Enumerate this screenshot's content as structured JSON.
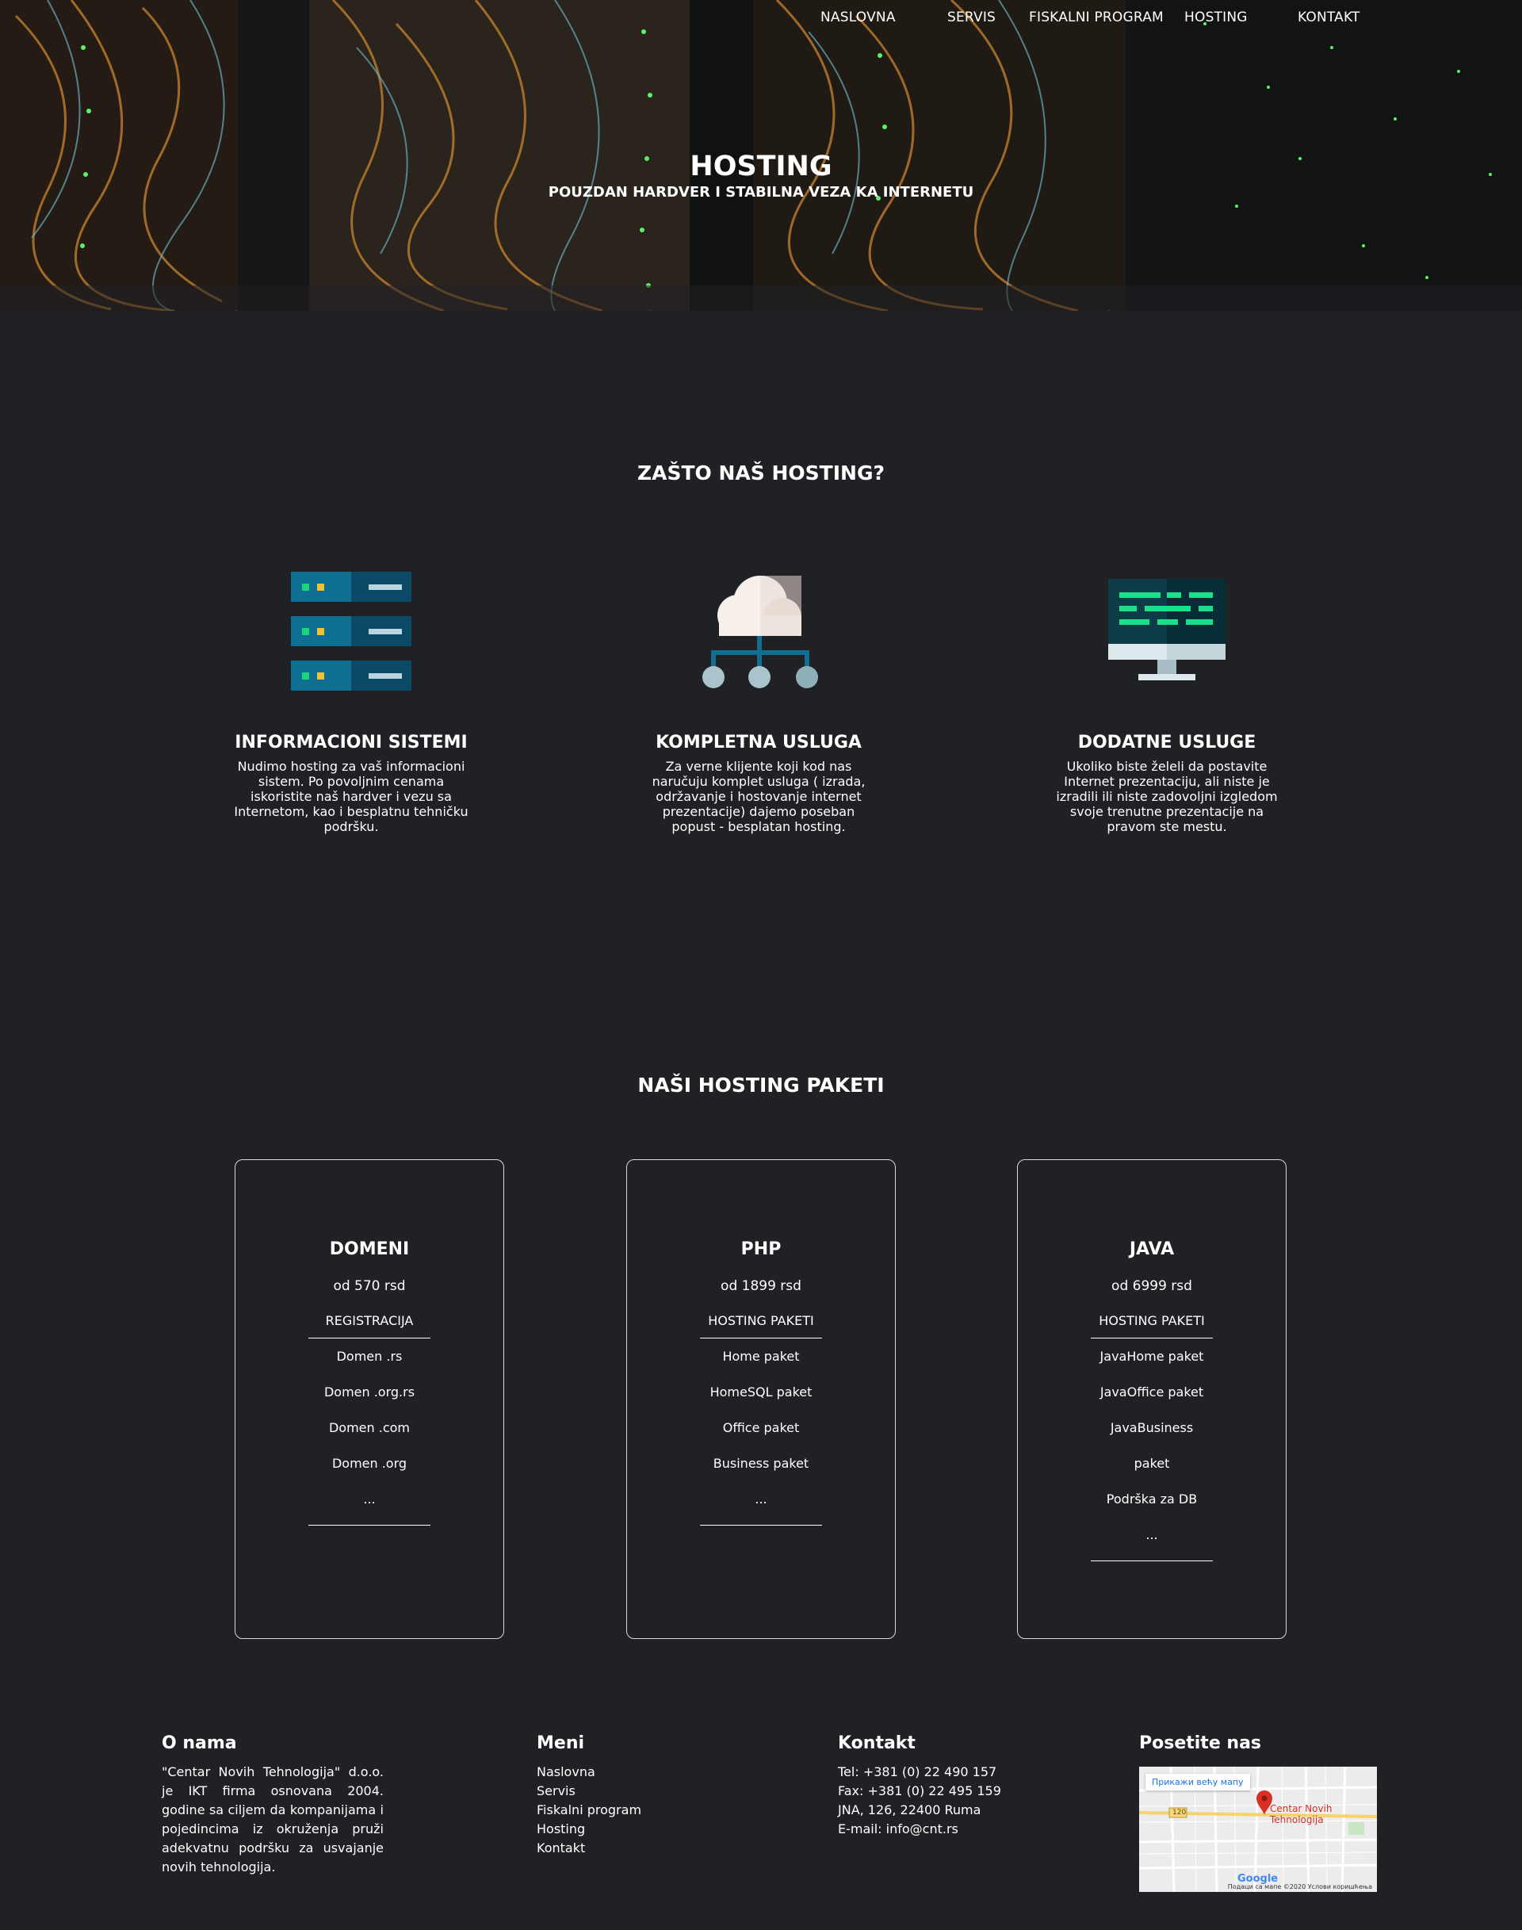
{
  "nav": {
    "items": [
      "NASLOVNA",
      "SERVIS",
      "FISKALNI PROGRAM",
      "HOSTING",
      "KONTAKT"
    ]
  },
  "hero": {
    "title": "HOSTING",
    "subtitle": "POUZDAN HARDVER I STABILNA VEZA KA INTERNETU"
  },
  "why": {
    "title": "ZAŠTO NAŠ HOSTING?",
    "features": [
      {
        "icon": "server-rack-icon",
        "title": "INFORMACIONI SISTEMI",
        "text": "Nudimo hosting za vaš informacioni sistem. Po povoljnim cenama iskoristite naš hardver i vezu sa Internetom, kao i besplatnu tehničku podršku."
      },
      {
        "icon": "cloud-network-icon",
        "title": "KOMPLETNA USLUGA",
        "text": "Za verne klijente koji kod nas naručuju komplet usluga ( izrada, održavanje i hostovanje internet prezentacije) dajemo poseban popust - besplatan hosting."
      },
      {
        "icon": "monitor-code-icon",
        "title": "DODATNE USLUGE",
        "text": "Ukoliko biste želeli da postavite Internet prezentaciju, ali niste je izradili ili niste zadovoljni izgledom svoje trenutne prezentacije na pravom ste mestu."
      }
    ]
  },
  "packages": {
    "title": "NAŠI HOSTING PAKETI",
    "cards": [
      {
        "title": "DOMENI",
        "price": "od 570 rsd",
        "category": "REGISTRACIJA",
        "items": [
          "Domen .rs",
          "Domen .org.rs",
          "Domen .com",
          "Domen .org",
          "..."
        ]
      },
      {
        "title": "PHP",
        "price": "od 1899 rsd",
        "category": "HOSTING PAKETI",
        "items": [
          "Home paket",
          "HomeSQL paket",
          "Office paket",
          "Business paket",
          "..."
        ]
      },
      {
        "title": "JAVA",
        "price": "od 6999 rsd",
        "category": "HOSTING PAKETI",
        "items": [
          "JavaHome paket",
          "JavaOffice paket",
          "JavaBusiness",
          "paket",
          "Podrška za DB",
          "..."
        ]
      }
    ]
  },
  "footer": {
    "about": {
      "title": "O nama",
      "text": "\"Centar Novih Tehnologija\" d.o.o. je IKT firma osnovana 2004. godine sa ciljem da kompanijama i pojedincima iz okruženja pruži adekvatnu podršku za usvajanje novih tehnologija."
    },
    "menu": {
      "title": "Meni",
      "links": [
        "Naslovna",
        "Servis",
        "Fiskalni program",
        "Hosting",
        "Kontakt"
      ]
    },
    "contact": {
      "title": "Kontakt",
      "lines": [
        "Tel: +381 (0) 22 490 157",
        "Fax: +381 (0) 22 495 159",
        "JNA, 126, 22400 Ruma",
        "E-mail: info@cnt.rs"
      ]
    },
    "visit": {
      "title": "Posetite nas",
      "map_button": "Прикажи већу мапу",
      "map_place": "Centar Novih Tehnologija",
      "map_road": "120",
      "map_logo": "Google",
      "map_credit": "Подаци са мапе ©2020   Услови коришћења"
    }
  },
  "colors": {
    "background": "#202124",
    "server_blue": "#0e6f93",
    "server_dark": "#0a4a66",
    "led_green": "#1ed67a",
    "led_yellow": "#f2c12e",
    "cloud_white": "#f7efea",
    "monitor_dark": "#0b3c48",
    "code_green": "#19e08a",
    "map_pin": "#d93025"
  }
}
